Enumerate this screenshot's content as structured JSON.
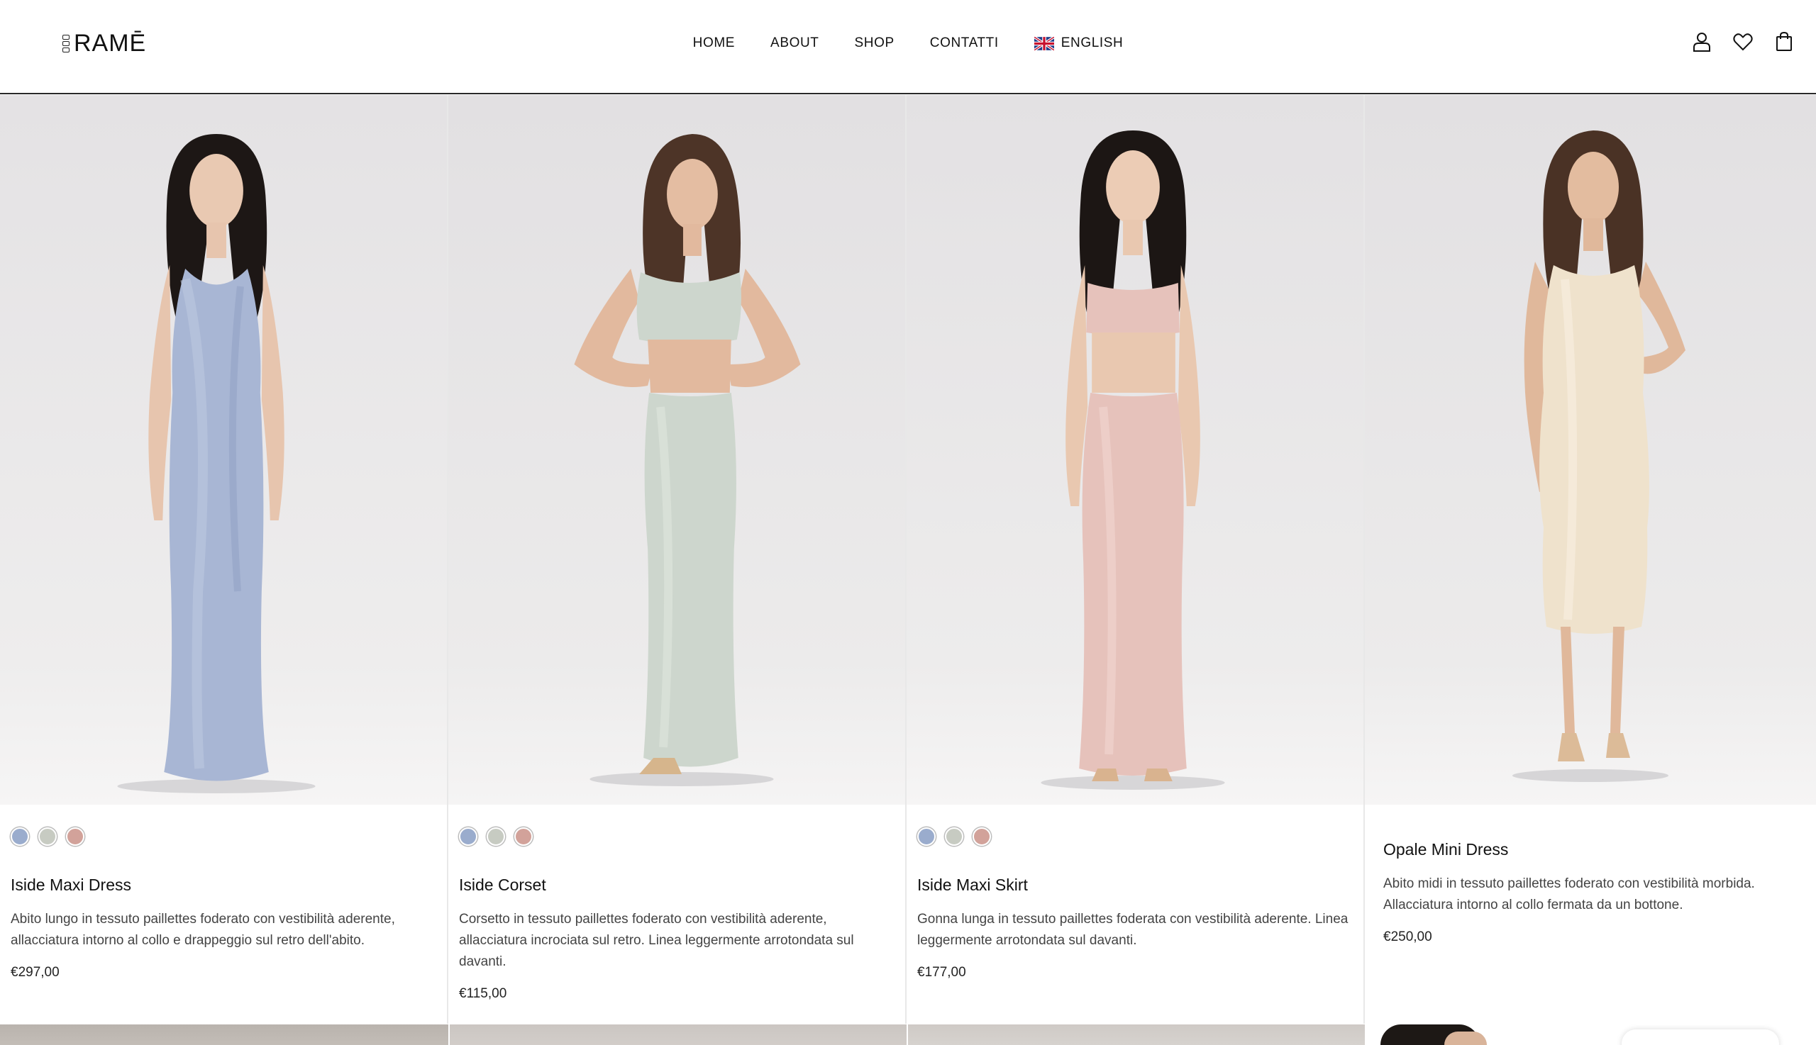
{
  "brand": {
    "logo_text": "RAMĒ",
    "logo_icon": "logo-mark-icon"
  },
  "nav": {
    "items": [
      {
        "label": "HOME"
      },
      {
        "label": "ABOUT"
      },
      {
        "label": "SHOP"
      },
      {
        "label": "CONTATTI"
      }
    ],
    "language": {
      "label": "ENGLISH",
      "icon": "uk-flag-icon"
    }
  },
  "header_icons": [
    "user-icon",
    "heart-icon",
    "shopping-bag-icon"
  ],
  "colors": {
    "swatch_blue": "#9aaccd",
    "swatch_sage": "#c7cbc2",
    "swatch_rose": "#d2a29a",
    "text_primary": "#111111",
    "text_secondary": "#444444"
  },
  "products": [
    {
      "name": "Iside Maxi Dress",
      "description": "Abito lungo in tessuto paillettes foderato con vestibilità aderente, allacciatura intorno al collo e drappeggio sul retro dell'abito.",
      "price": "€297,00",
      "swatches": [
        "#9aaccd",
        "#c7cbc2",
        "#d2a29a"
      ],
      "garment_color": "#a8b6d4"
    },
    {
      "name": "Iside Corset",
      "description": "Corsetto in tessuto paillettes foderato con vestibilità aderente, allacciatura incrociata sul retro. Linea leggermente arrotondata sul davanti.",
      "price": "€115,00",
      "swatches": [
        "#9aaccd",
        "#c7cbc2",
        "#d2a29a"
      ],
      "garment_color": "#cdd6cd"
    },
    {
      "name": "Iside Maxi Skirt",
      "description": "Gonna lunga in tessuto paillettes foderata con vestibilità aderente. Linea leggermente arrotondata sul davanti.",
      "price": "€177,00",
      "swatches": [
        "#9aaccd",
        "#c7cbc2",
        "#d2a29a"
      ],
      "garment_color": "#e6c2bb"
    },
    {
      "name": "Opale Mini Dress",
      "description": "Abito midi in tessuto paillettes foderato con vestibilità morbida. Allacciatura intorno al collo fermata da un bottone.",
      "price": "€250,00",
      "swatches": [],
      "garment_color": "#efe2cc"
    }
  ]
}
